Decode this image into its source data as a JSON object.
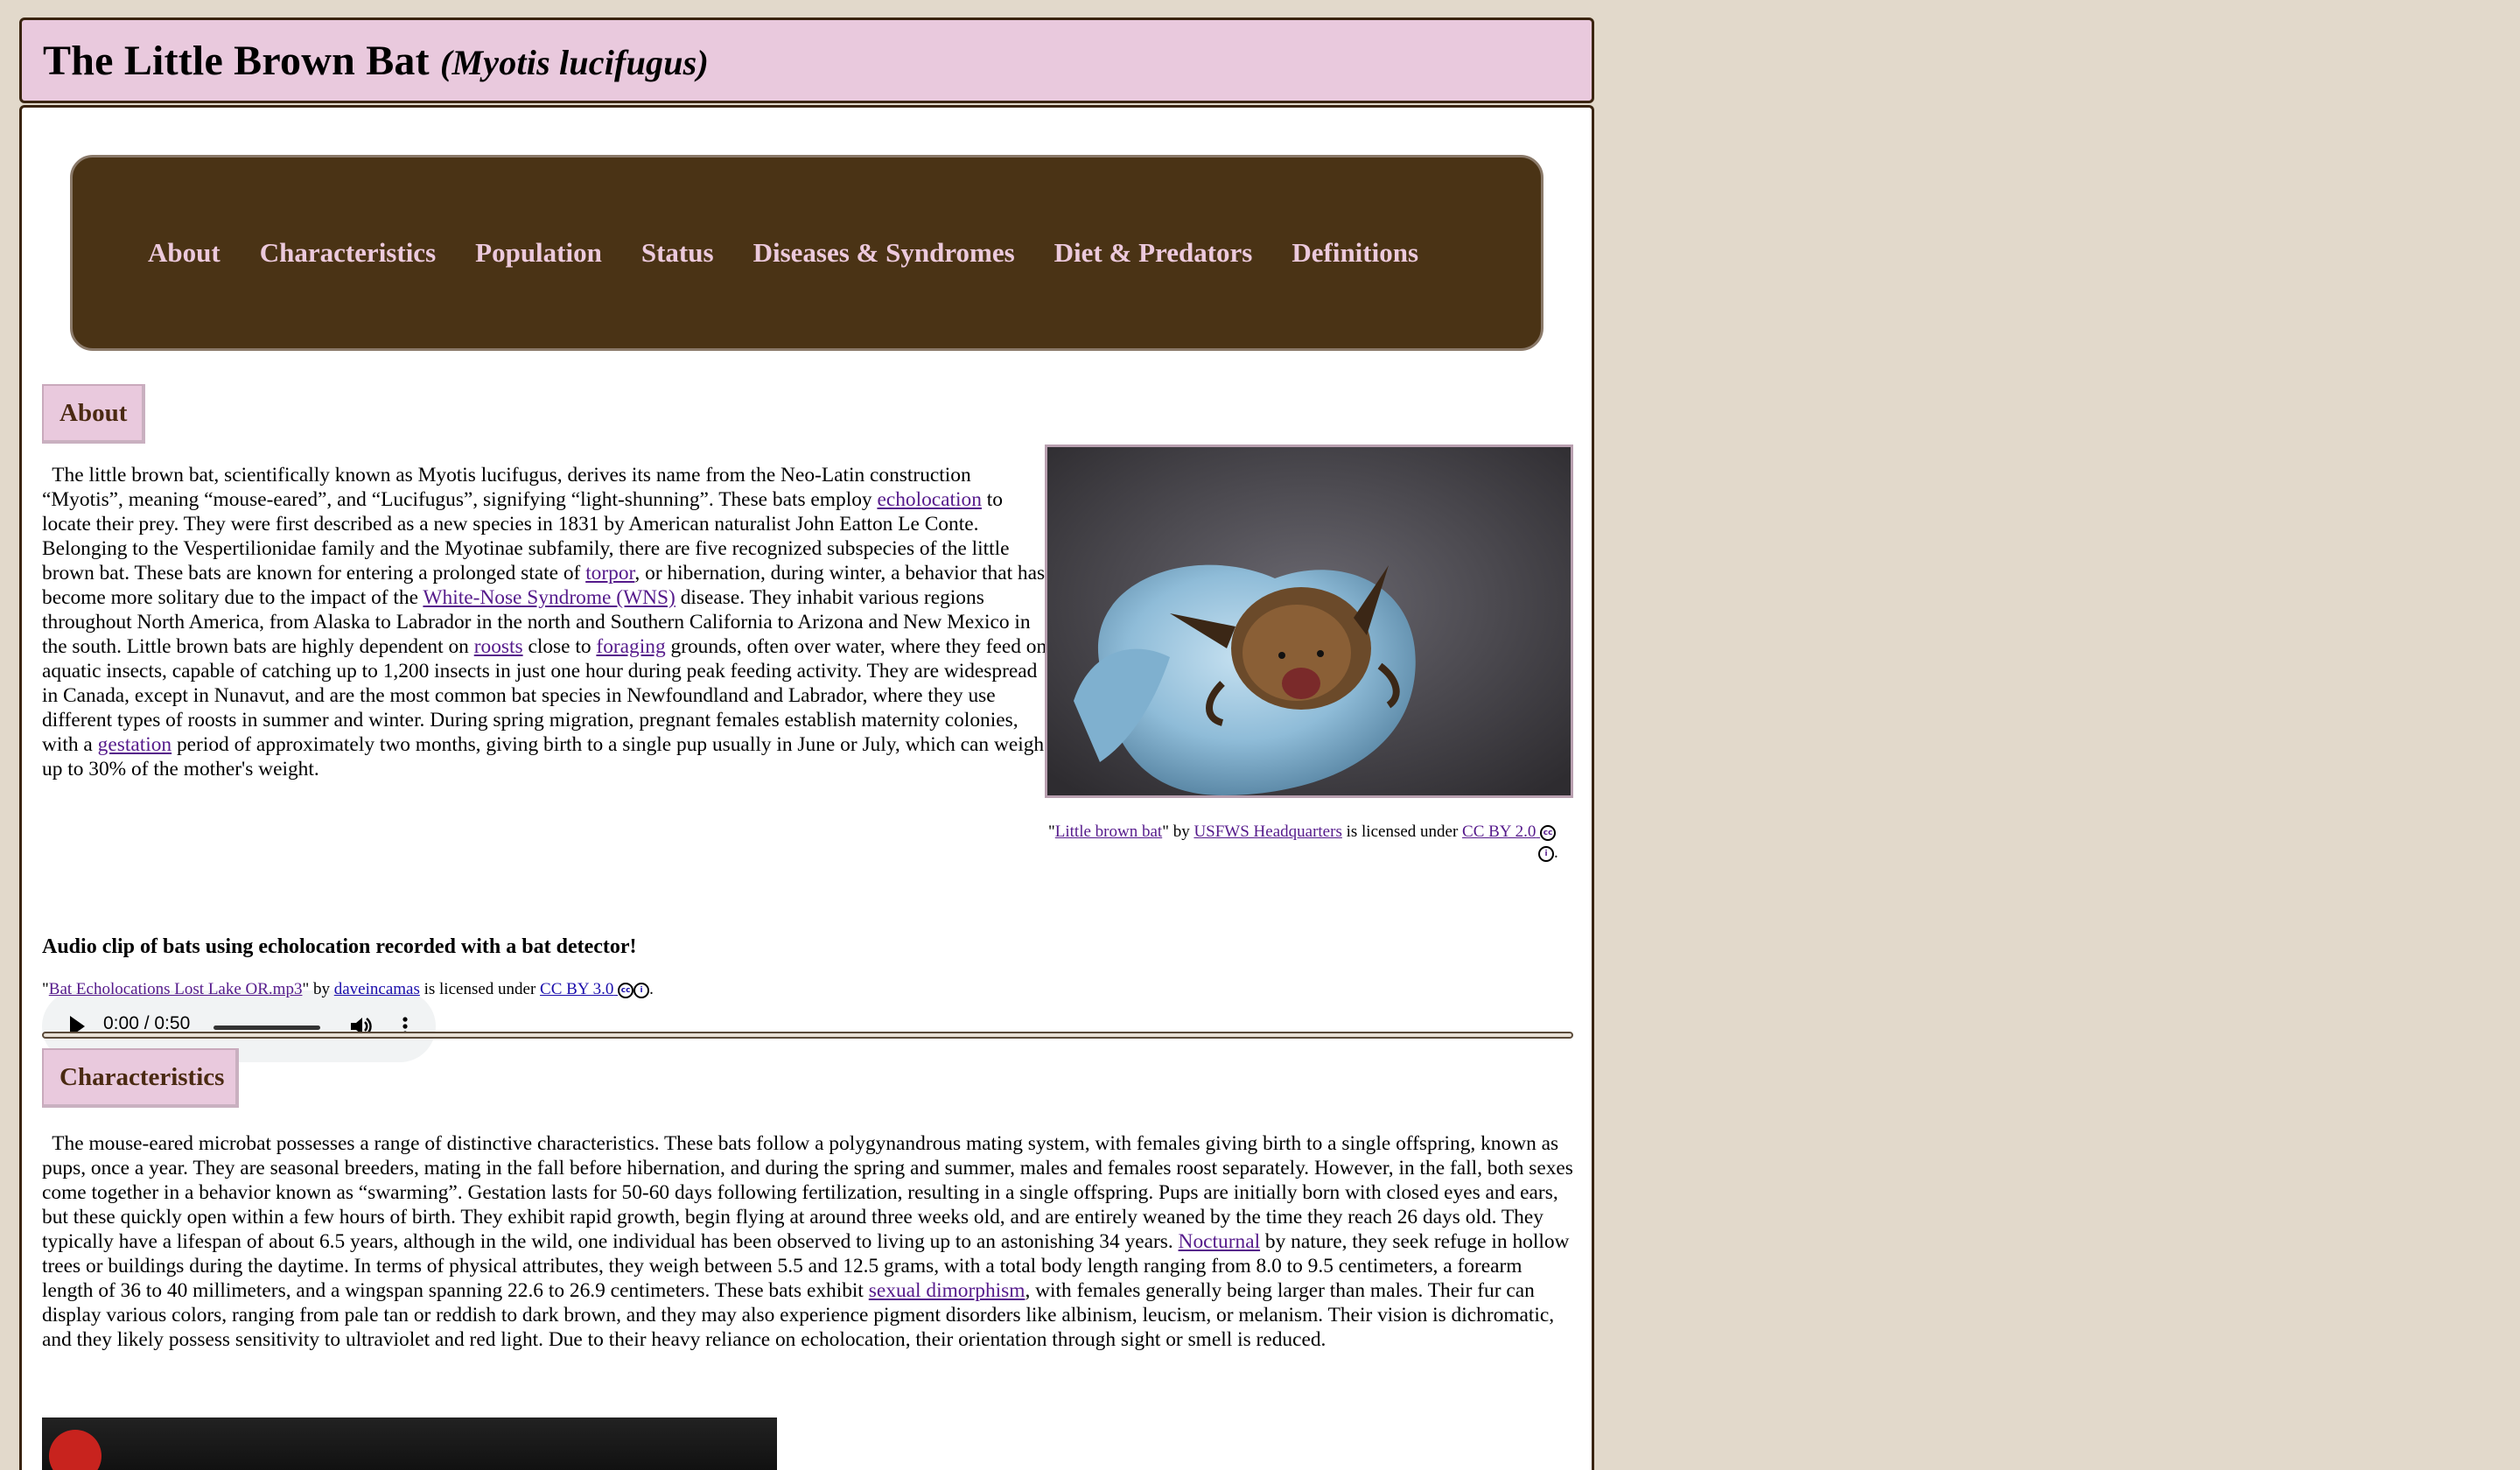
{
  "header": {
    "title": "The Little Brown Bat",
    "scientific_name": "(Myotis lucifugus)"
  },
  "nav": {
    "items": [
      {
        "label": "About"
      },
      {
        "label": "Characteristics"
      },
      {
        "label": "Population"
      },
      {
        "label": "Status"
      },
      {
        "label": "Diseases & Syndromes"
      },
      {
        "label": "Diet & Predators"
      },
      {
        "label": "Definitions"
      }
    ]
  },
  "about": {
    "heading": "About",
    "text_1": "  The little brown bat, scientifically known as Myotis lucifugus, derives its name from the Neo-Latin construction “Myotis”, meaning “mouse-eared”, and “Lucifugus”, signifying “light-shunning”. These bats employ ",
    "link_echolocation": "echolocation",
    "text_2": " to locate their prey. They were first described as a new species in 1831 by American naturalist John Eatton Le Conte. Belonging to the Vespertilionidae family and the Myotinae subfamily, there are five recognized subspecies of the little brown bat. These bats are known for entering a prolonged state of ",
    "link_torpor": "torpor",
    "text_3": ", or hibernation, during winter, a behavior that has become more solitary due to the impact of the ",
    "link_wns": "White-Nose Syndrome (WNS)",
    "text_4": " disease. They inhabit various regions throughout North America, from Alaska to Labrador in the north and Southern California to Arizona and New Mexico in the south. Little brown bats are highly dependent on ",
    "link_roosts": "roosts",
    "text_5": " close to ",
    "link_foraging": "foraging",
    "text_6": " grounds, often over water, where they feed on aquatic insects, capable of catching up to 1,200 insects in just one hour during peak feeding activity. They are widespread in Canada, except in Nunavut, and are the most common bat species in Newfoundland and Labrador, where they use different types of roosts in summer and winter. During spring migration, pregnant females establish maternity colonies, with a ",
    "link_gestation": "gestation",
    "text_7": " period of approximately two months, giving birth to a single pup usually in June or July, which can weigh up to 30% of the mother's weight.",
    "photo_credit": {
      "q1": "\"",
      "title": "Little brown bat",
      "q2": "\" by ",
      "author": "USFWS Headquarters",
      "mid": " is licensed under ",
      "license": "CC BY 2.0",
      "end": "."
    },
    "audio_title": "Audio clip of bats using echolocation recorded with a bat detector!",
    "audio_time": "0:00 / 0:50",
    "audio_credit": {
      "q1": "\"",
      "title": "Bat Echolocations Lost Lake OR.mp3",
      "q2": "\" by ",
      "author": "daveincamas",
      "mid": " is licensed under ",
      "license": "CC BY 3.0",
      "end": "."
    }
  },
  "characteristics": {
    "heading": "Characteristics",
    "text_1": "  The mouse-eared microbat possesses a range of distinctive characteristics. These bats follow a polygynandrous mating system, with females giving birth to a single offspring, known as pups, once a year. They are seasonal breeders, mating in the fall before hibernation, and during the spring and summer, males and females roost separately. However, in the fall, both sexes come together in a behavior known as “swarming”. Gestation lasts for 50-60 days following fertilization, resulting in a single offspring. Pups are initially born with closed eyes and ears, but these quickly open within a few hours of birth. They exhibit rapid growth, begin flying at around three weeks old, and are entirely weaned by the time they reach 26 days old. They typically have a lifespan of about 6.5 years, although in the wild, one individual has been observed to living up to an astonishing 34 years. ",
    "link_nocturnal": "Nocturnal",
    "text_2": " by nature, they seek refuge in hollow trees or buildings during the daytime. In terms of physical attributes, they weigh between 5.5 and 12.5 grams, with a total body length ranging from 8.0 to 9.5 centimeters, a forearm length of 36 to 40 millimeters, and a wingspan spanning 22.6 to 26.9 centimeters. These bats exhibit ",
    "link_dimorphism": "sexual dimorphism",
    "text_3": ", with females generally being larger than males. Their fur can display various colors, ranging from pale tan or reddish to dark brown, and they may also experience pigment disorders like albinism, leucism, or melanism. Their vision is dichromatic, and they likely possess sensitivity to ultraviolet and red light. Due to their heavy reliance on echolocation, their orientation through sight or smell is reduced."
  },
  "icons": {
    "cc": "CC",
    "by": "i"
  }
}
